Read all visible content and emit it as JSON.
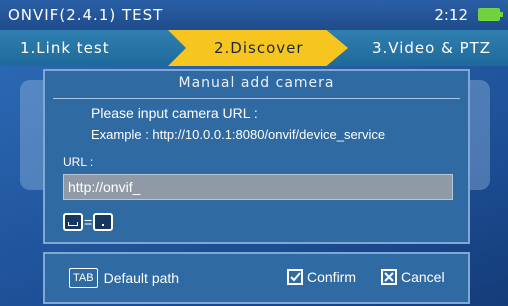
{
  "header": {
    "title": "ONVIF(2.4.1) TEST",
    "time": "2:12"
  },
  "steps": [
    {
      "label": "1.Link test"
    },
    {
      "label": "2.Discover"
    },
    {
      "label": "3.Video & PTZ"
    }
  ],
  "dialog": {
    "title": "Manual add camera",
    "instruction": "Please input camera URL :",
    "example": "Example : http://10.0.0.1:8080/onvif/device_service",
    "url_label": "URL :",
    "url_value": "http://onvif_",
    "key_equals": "="
  },
  "footer": {
    "tab_key": "TAB",
    "default_path_label": "Default path",
    "confirm_label": "Confirm",
    "cancel_label": "Cancel"
  },
  "colors": {
    "accent": "#f7c520",
    "battery": "#6fd23c"
  }
}
